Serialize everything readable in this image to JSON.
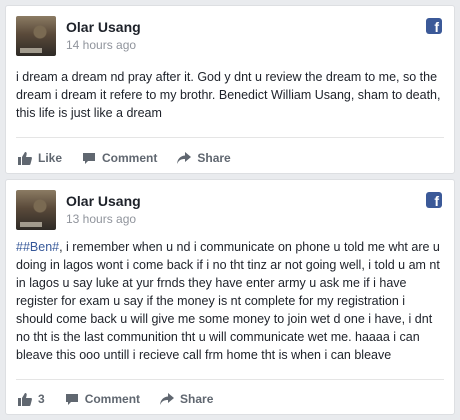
{
  "posts": [
    {
      "author": "Olar Usang",
      "time": "14 hours ago",
      "hashtag": "",
      "text": "i dream a dream nd pray after it. God y dnt u review the dream to me, so the dream i dream it refere to my brothr. Benedict William Usang, sham to death, this life is just like a dream",
      "actions": {
        "like": "Like",
        "comment": "Comment",
        "share": "Share"
      }
    },
    {
      "author": "Olar Usang",
      "time": "13 hours ago",
      "hashtag": "##Ben#",
      "text": ", i remember when u nd i communicate on phone u told me wht are u doing in lagos wont i come back if i no tht tinz ar not going well, i told u am nt in lagos u say luke at yur frnds they have enter army u ask me if i have register for exam u say if the money is nt complete for my registration i should come back u will give me some money to join wet d one i have, i dnt no tht is the last communition tht u will communicate wet me. haaaa i can bleave this ooo untill i recieve call frm home tht is when i can bleave",
      "actions": {
        "like_count": "3",
        "comment": "Comment",
        "share": "Share"
      }
    }
  ],
  "colors": {
    "background": "#e9ebee",
    "brand": "#3b5998",
    "hashtag": "#365899",
    "muted": "#90949c"
  },
  "icons": {
    "facebook": "facebook-icon",
    "like": "thumbs-up-icon",
    "comment": "comment-icon",
    "share": "share-icon"
  }
}
